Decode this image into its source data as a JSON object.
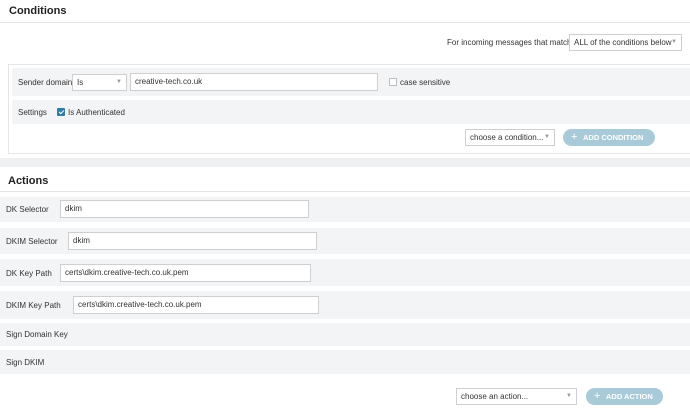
{
  "conditions": {
    "title": "Conditions",
    "match_label": "For incoming messages that match",
    "match_select": "ALL of the conditions below",
    "sender_domain": {
      "label": "Sender domain",
      "operator": "Is",
      "value": "creative-tech.co.uk",
      "case_label": "case sensitive",
      "case_checked": false
    },
    "settings": {
      "label": "Settings",
      "auth_label": "Is Authenticated",
      "auth_checked": true
    },
    "choose_placeholder": "choose a condition...",
    "add_button": "ADD CONDITION"
  },
  "actions": {
    "title": "Actions",
    "rows": [
      {
        "label": "DK Selector",
        "value": "dkim"
      },
      {
        "label": "DKIM Selector",
        "value": "dkim"
      },
      {
        "label": "DK Key Path",
        "value": "certs\\dkim.creative-tech.co.uk.pem"
      },
      {
        "label": "DKIM Key Path",
        "value": "certs\\dkim.creative-tech.co.uk.pem"
      },
      {
        "label": "Sign Domain Key"
      },
      {
        "label": "Sign DKIM"
      }
    ],
    "choose_placeholder": "choose an action...",
    "add_button": "ADD ACTION"
  },
  "icons": {
    "caret": "chevron-down-icon",
    "plus": "plus-icon",
    "check": "checkmark-icon"
  },
  "colors": {
    "accent": "#2f7ea6",
    "button_disabled": "#a9cbd9",
    "row_bg": "#f3f4f5"
  }
}
